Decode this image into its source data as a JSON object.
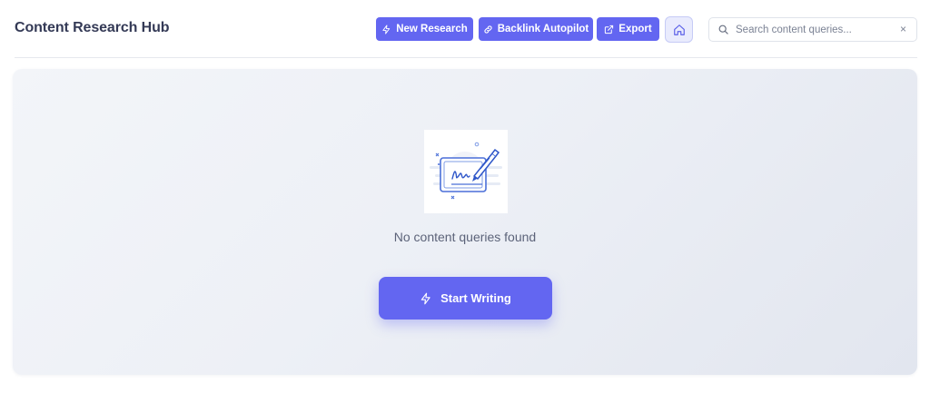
{
  "header": {
    "title": "Content Research Hub",
    "new_research_label": "New Research",
    "backlink_label": "Backlink Autopilot",
    "export_label": "Export",
    "search_placeholder": "Search content queries...",
    "clear_symbol": "×"
  },
  "empty_state": {
    "message": "No content queries found",
    "cta_label": "Start Writing",
    "illustration": "signature-pen-icon"
  },
  "icons": {
    "new_research": "lightning-icon",
    "backlink": "link-icon",
    "export": "external-link-icon",
    "home": "home-icon",
    "search": "search-icon",
    "cta": "lightning-icon"
  },
  "colors": {
    "accent": "#6366f1",
    "home_bg": "#e9ebfd",
    "title_text": "#343a56",
    "muted_text": "#5c6379"
  }
}
